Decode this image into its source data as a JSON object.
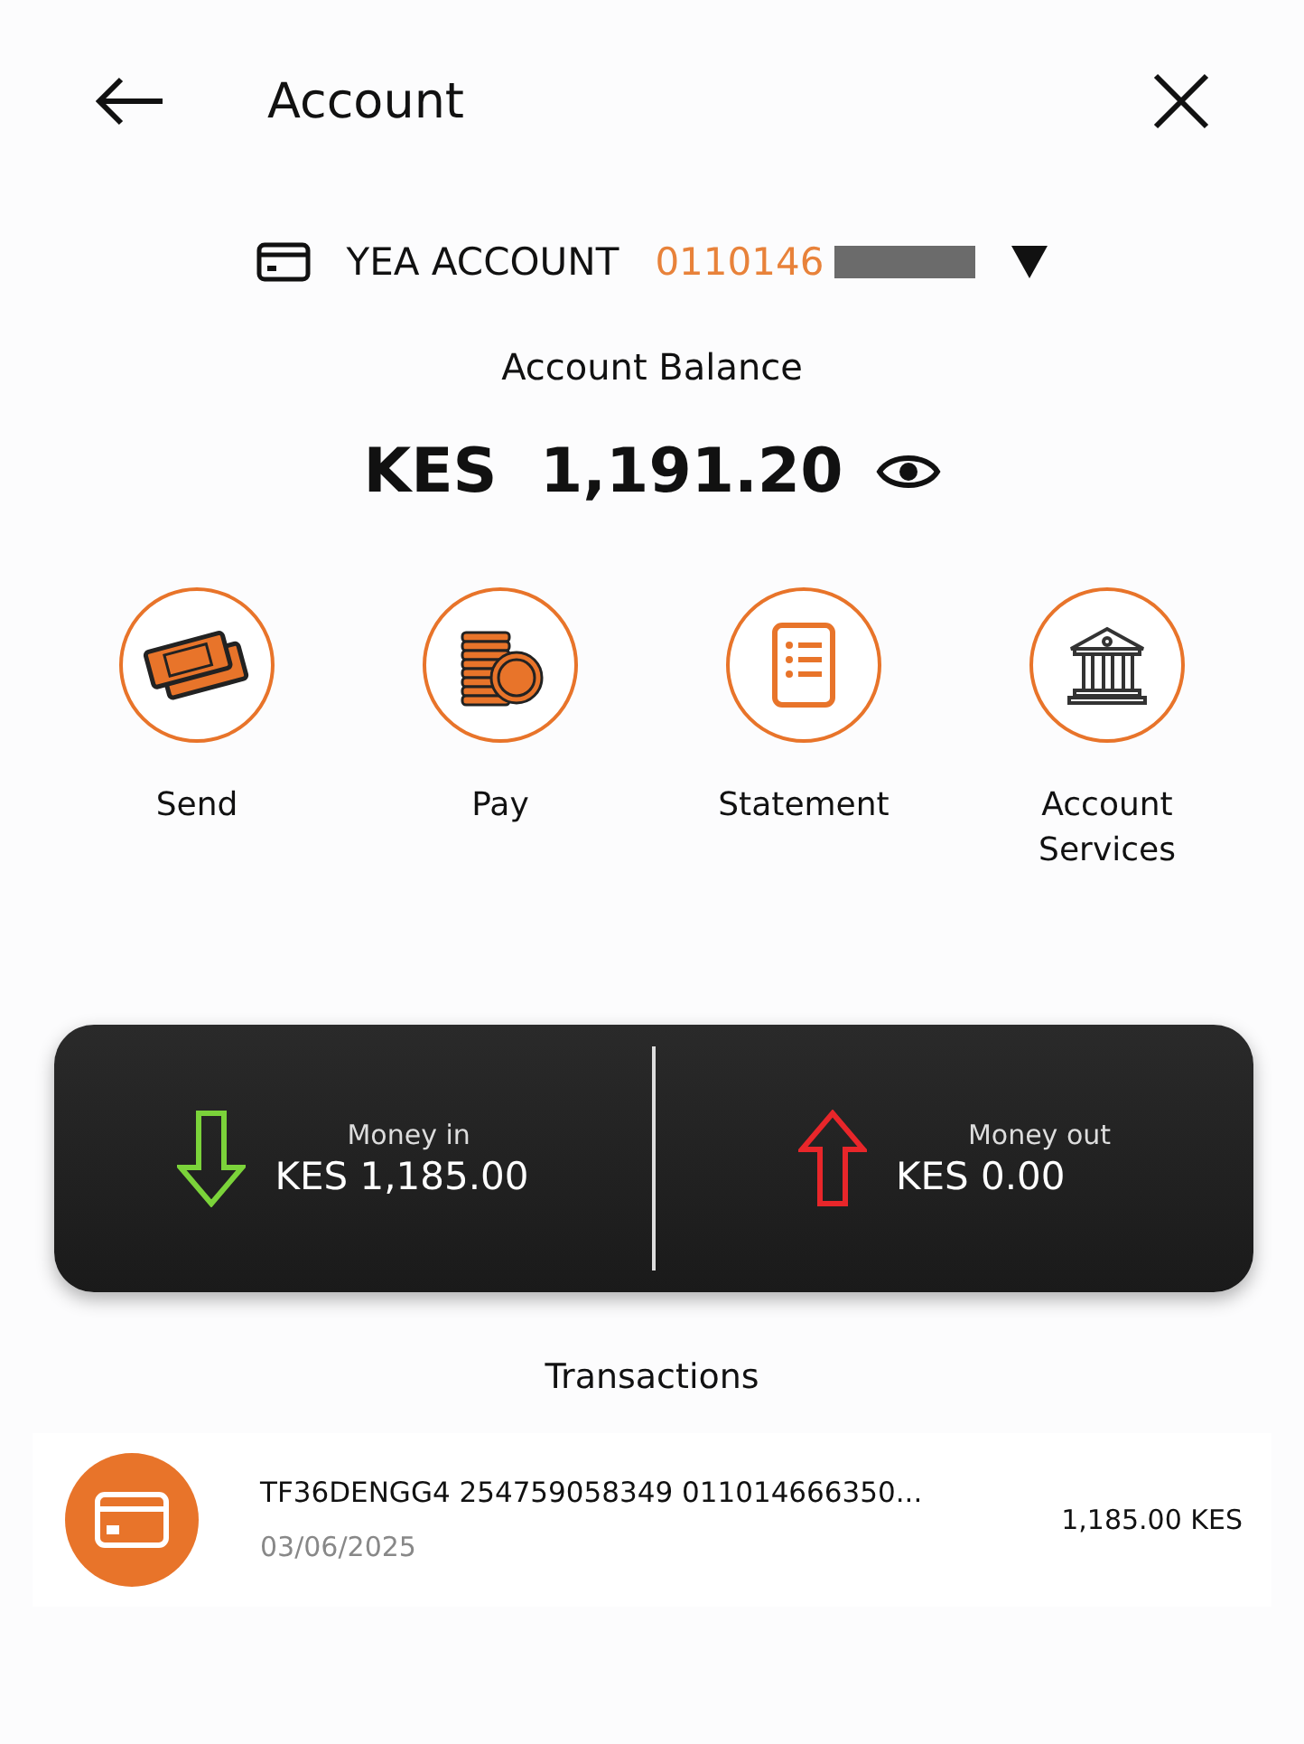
{
  "header": {
    "title": "Account"
  },
  "account": {
    "name": "YEA ACCOUNT",
    "number": "0110146"
  },
  "balance": {
    "label": "Account Balance",
    "currency": "KES",
    "amount": "1,191.20"
  },
  "actions": [
    {
      "kind": "money",
      "label": "Send"
    },
    {
      "kind": "coins",
      "label": "Pay"
    },
    {
      "kind": "document",
      "label": "Statement"
    },
    {
      "kind": "bank",
      "label": "Account Services"
    }
  ],
  "summary": [
    {
      "kind": "in",
      "label": "Money in",
      "value": "KES 1,185.00"
    },
    {
      "kind": "out",
      "label": "Money out",
      "value": "KES 0.00"
    }
  ],
  "transactions_title": "Transactions",
  "transactions": [
    {
      "description": "TF36DENGG4 254759058349 011014666350...",
      "date": "03/06/2025",
      "amount": "1,185.00 KES"
    }
  ]
}
